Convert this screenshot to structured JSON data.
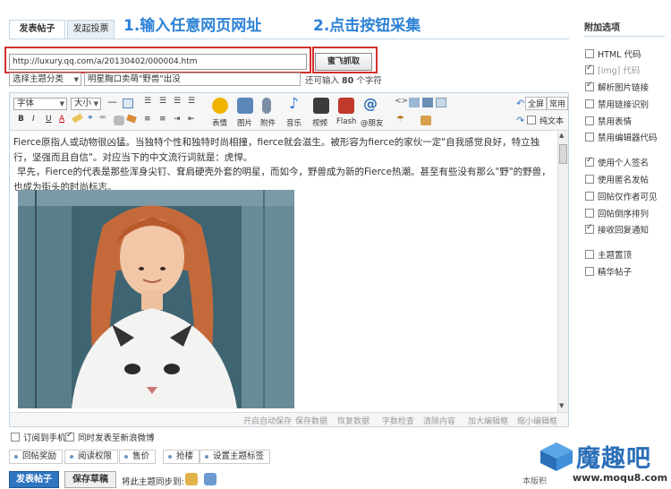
{
  "tabs": [
    {
      "label": "发表帖子"
    },
    {
      "label": "发起投票"
    }
  ],
  "annotation": {
    "step1": "1.输入任意网页网址",
    "step2": "2.点击按钮采集"
  },
  "url_input": {
    "value": "http://luxury.qq.com/a/20130402/000004.htm"
  },
  "grab_button": {
    "label": "蜜飞抓取"
  },
  "category_select": {
    "value": "选择主题分类"
  },
  "title_input": {
    "value": "明星胸口卖萌\"野兽\"出没"
  },
  "remaining": {
    "prefix": "还可输入",
    "count": "80",
    "suffix": "个字符"
  },
  "toolbar": {
    "font": "字体",
    "size": "大小",
    "big_buttons": [
      {
        "label": "表情",
        "color": "#f0b400",
        "icon": "smiley-icon"
      },
      {
        "label": "图片",
        "color": "#5b87b8",
        "icon": "image-icon"
      },
      {
        "label": "附件",
        "color": "#7a8ea3",
        "icon": "paperclip-icon"
      },
      {
        "label": "音乐",
        "color": "#3a7bd5",
        "icon": "music-icon"
      },
      {
        "label": "视频",
        "color": "#3b3b3b",
        "icon": "video-icon"
      },
      {
        "label": "Flash",
        "color": "#c0392b",
        "icon": "flash-icon"
      },
      {
        "label": "@朋友",
        "color": "#2f6fb5",
        "icon": "at-icon"
      }
    ],
    "fullscreen": "全屏",
    "common": "常用",
    "plaintext": "纯文本"
  },
  "content": {
    "para1": "Fierce原指人或动物很凶猛。当独特个性和独特时尚相撞，fierce就会滋生。被形容为fierce的家伙一定\"自我感觉良好，特立独行，坚强而且自信\"。对应当下的中文流行词就是：虎悍。",
    "para2": "早先，Fierce的代表是那些浑身尖钉、耷肩硬壳外套的明星，而如今，野兽成为新的Fierce热潮。甚至有些没有那么\"野\"的野兽，也成为街头的时尚标志。"
  },
  "statusbar": {
    "items": [
      "开启自动保存",
      "保存数据",
      "恢复数据",
      "字数检查",
      "清除内容",
      "加大编辑框",
      "缩小编辑框"
    ]
  },
  "options": {
    "title": "附加选项",
    "items": [
      {
        "label": "HTML 代码",
        "checked": false,
        "disabled": false
      },
      {
        "label": "[img] 代码",
        "checked": true,
        "disabled": true
      },
      {
        "label": "解析图片链接",
        "checked": true,
        "disabled": false
      },
      {
        "label": "禁用链接识别",
        "checked": false,
        "disabled": false
      },
      {
        "label": "禁用表情",
        "checked": false,
        "disabled": false
      },
      {
        "label": "禁用编辑器代码",
        "checked": false,
        "disabled": false
      },
      {
        "label": "使用个人签名",
        "checked": true,
        "disabled": false
      },
      {
        "label": "使用匿名发帖",
        "checked": false,
        "disabled": false
      },
      {
        "label": "回帖仅作者可见",
        "checked": false,
        "disabled": false
      },
      {
        "label": "回帖倒序排列",
        "checked": false,
        "disabled": false
      },
      {
        "label": "接收回复通知",
        "checked": true,
        "disabled": false
      },
      {
        "label": "主题置顶",
        "checked": false,
        "disabled": false
      },
      {
        "label": "精华帖子",
        "checked": false,
        "disabled": false
      }
    ]
  },
  "below_editor": {
    "subscribe": "订阅到手机",
    "weibo": "同时发表至新浪微博"
  },
  "extra_buttons": [
    "回帖奖励",
    "阅读权限",
    "售价",
    "抢楼",
    "设置主题标签"
  ],
  "submit": {
    "post": "发表帖子",
    "draft": "保存草稿",
    "sync_label": "将此主题同步到:",
    "side_text": "本版积"
  },
  "watermark": {
    "brand": "魔趣吧",
    "url": "www.moqu8.com"
  }
}
